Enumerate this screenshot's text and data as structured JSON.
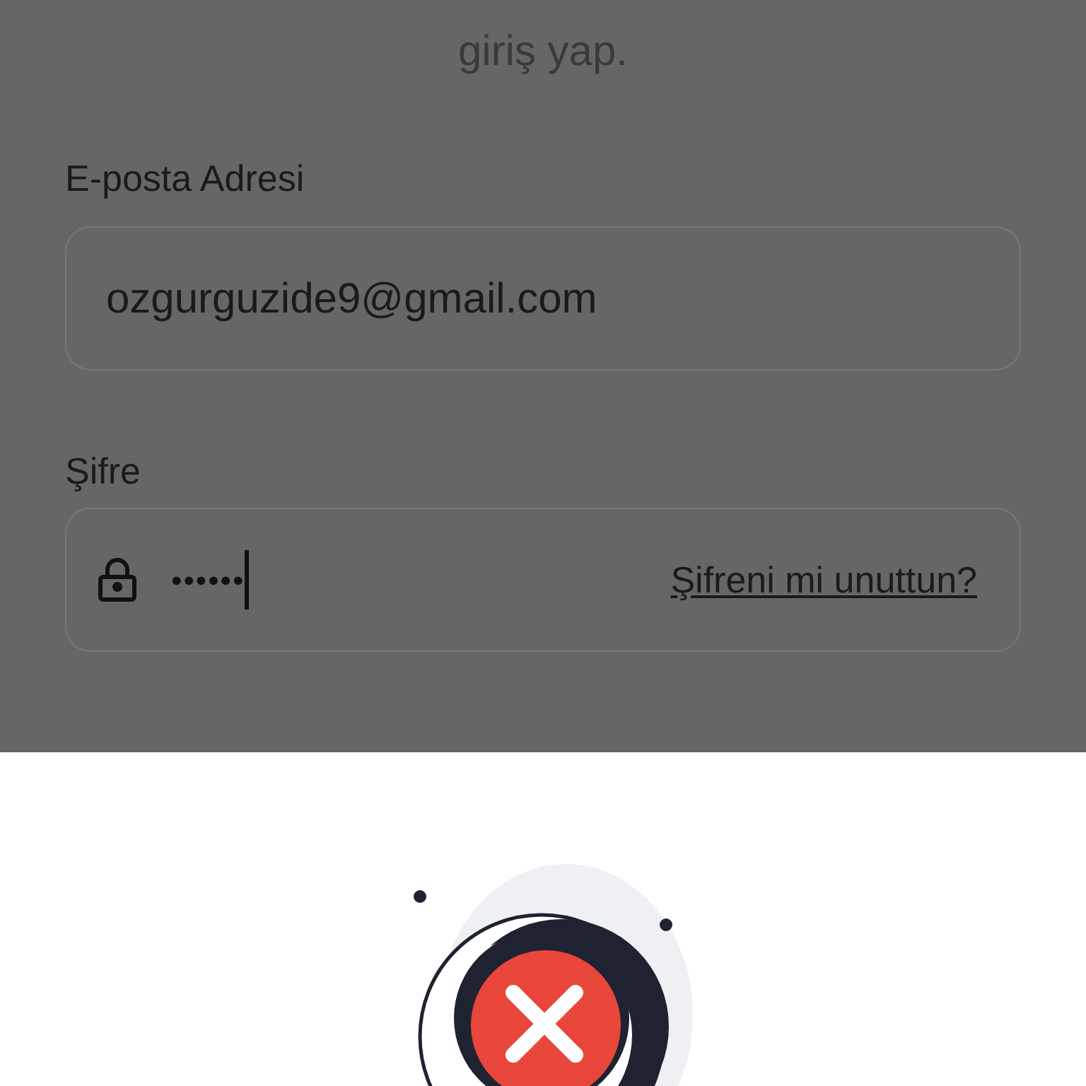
{
  "heading": "giriş yap.",
  "email": {
    "label": "E-posta Adresi",
    "value": "ozgurguzide9@gmail.com"
  },
  "password": {
    "label": "Şifre",
    "value": "••••••",
    "focused": true,
    "forgot_link": "Şifreni mi unuttun?"
  }
}
